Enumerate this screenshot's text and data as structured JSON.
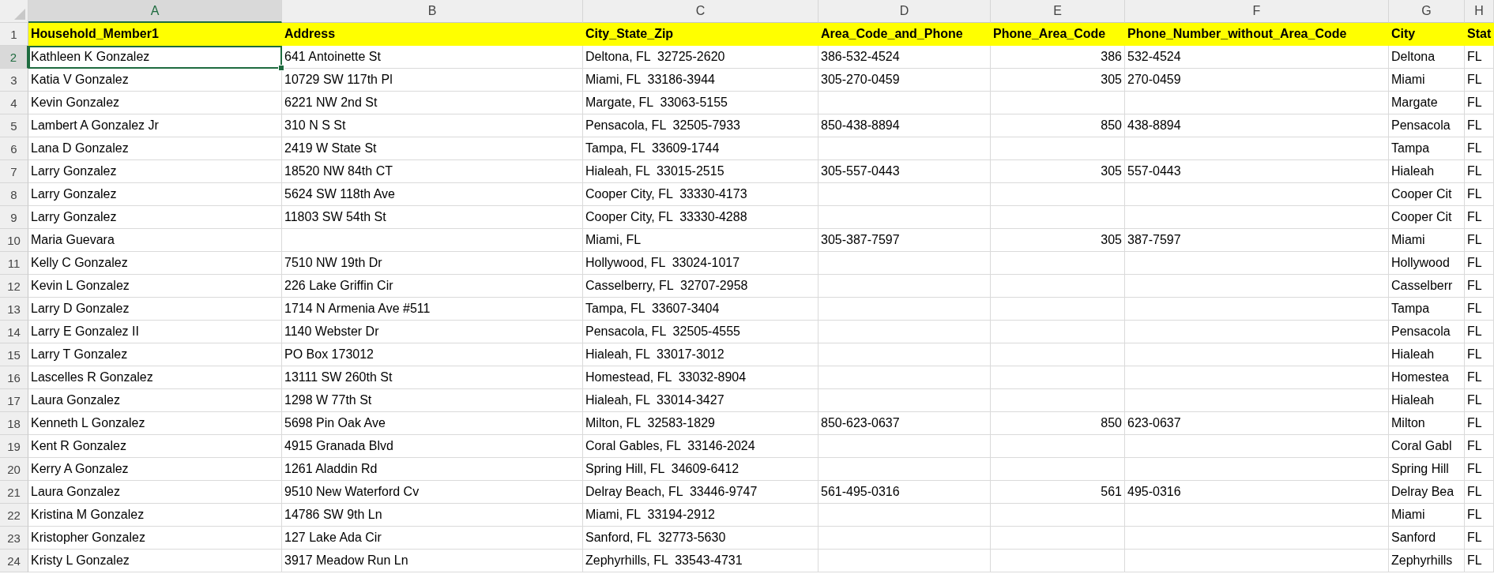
{
  "columns": [
    {
      "letter": "A",
      "selected": true,
      "right_aligned": false
    },
    {
      "letter": "B",
      "selected": false,
      "right_aligned": false
    },
    {
      "letter": "C",
      "selected": false,
      "right_aligned": false
    },
    {
      "letter": "D",
      "selected": false,
      "right_aligned": false
    },
    {
      "letter": "E",
      "selected": false,
      "right_aligned": true
    },
    {
      "letter": "F",
      "selected": false,
      "right_aligned": false
    },
    {
      "letter": "G",
      "selected": false,
      "right_aligned": false
    },
    {
      "letter": "H",
      "selected": false,
      "right_aligned": false
    }
  ],
  "rows": [
    {
      "number": "1",
      "selected": false,
      "kind": "header",
      "cells": [
        "Household_Member1",
        "Address",
        "City_State_Zip",
        "Area_Code_and_Phone",
        "Phone_Area_Code",
        "Phone_Number_without_Area_Code",
        "City",
        "Stat"
      ]
    },
    {
      "number": "2",
      "selected": true,
      "kind": "data",
      "cells": [
        "Kathleen K Gonzalez",
        "641 Antoinette St",
        "Deltona, FL  32725-2620",
        "386-532-4524",
        "386",
        "532-4524",
        "Deltona",
        "FL"
      ]
    },
    {
      "number": "3",
      "selected": false,
      "kind": "data",
      "cells": [
        "Katia V Gonzalez",
        "10729 SW 117th Pl",
        "Miami, FL  33186-3944",
        "305-270-0459",
        "305",
        "270-0459",
        "Miami",
        "FL"
      ]
    },
    {
      "number": "4",
      "selected": false,
      "kind": "data",
      "cells": [
        "Kevin Gonzalez",
        "6221 NW 2nd St",
        "Margate, FL  33063-5155",
        null,
        null,
        null,
        "Margate",
        "FL"
      ]
    },
    {
      "number": "5",
      "selected": false,
      "kind": "data",
      "cells": [
        "Lambert A Gonzalez Jr",
        "310 N S St",
        "Pensacola, FL  32505-7933",
        "850-438-8894",
        "850",
        "438-8894",
        "Pensacola",
        "FL"
      ]
    },
    {
      "number": "6",
      "selected": false,
      "kind": "data",
      "cells": [
        "Lana D Gonzalez",
        "2419 W State St",
        "Tampa, FL  33609-1744",
        null,
        null,
        null,
        "Tampa",
        "FL"
      ]
    },
    {
      "number": "7",
      "selected": false,
      "kind": "data",
      "cells": [
        "Larry Gonzalez",
        "18520 NW 84th CT",
        "Hialeah, FL  33015-2515",
        "305-557-0443",
        "305",
        "557-0443",
        "Hialeah",
        "FL"
      ]
    },
    {
      "number": "8",
      "selected": false,
      "kind": "data",
      "cells": [
        "Larry Gonzalez",
        "5624 SW 118th Ave",
        "Cooper City, FL  33330-4173",
        null,
        null,
        null,
        "Cooper Cit",
        "FL"
      ]
    },
    {
      "number": "9",
      "selected": false,
      "kind": "data",
      "cells": [
        "Larry Gonzalez",
        "11803 SW 54th St",
        "Cooper City, FL  33330-4288",
        null,
        null,
        null,
        "Cooper Cit",
        "FL"
      ]
    },
    {
      "number": "10",
      "selected": false,
      "kind": "data",
      "cells": [
        "Maria Guevara",
        null,
        "Miami, FL",
        "305-387-7597",
        "305",
        "387-7597",
        "Miami",
        "FL"
      ]
    },
    {
      "number": "11",
      "selected": false,
      "kind": "data",
      "cells": [
        "Kelly C Gonzalez",
        "7510 NW 19th Dr",
        "Hollywood, FL  33024-1017",
        null,
        null,
        null,
        "Hollywood",
        "FL"
      ]
    },
    {
      "number": "12",
      "selected": false,
      "kind": "data",
      "cells": [
        "Kevin L Gonzalez",
        "226 Lake Griffin Cir",
        "Casselberry, FL  32707-2958",
        null,
        null,
        null,
        "Casselberr",
        "FL"
      ]
    },
    {
      "number": "13",
      "selected": false,
      "kind": "data",
      "cells": [
        "Larry D Gonzalez",
        "1714 N Armenia Ave #511",
        "Tampa, FL  33607-3404",
        null,
        null,
        null,
        "Tampa",
        "FL"
      ]
    },
    {
      "number": "14",
      "selected": false,
      "kind": "data",
      "cells": [
        "Larry E Gonzalez II",
        "1140 Webster Dr",
        "Pensacola, FL  32505-4555",
        null,
        null,
        null,
        "Pensacola",
        "FL"
      ]
    },
    {
      "number": "15",
      "selected": false,
      "kind": "data",
      "cells": [
        "Larry T Gonzalez",
        "PO Box 173012",
        "Hialeah, FL  33017-3012",
        null,
        null,
        null,
        "Hialeah",
        "FL"
      ]
    },
    {
      "number": "16",
      "selected": false,
      "kind": "data",
      "cells": [
        "Lascelles R Gonzalez",
        "13111 SW 260th St",
        "Homestead, FL  33032-8904",
        null,
        null,
        null,
        "Homestea",
        "FL"
      ]
    },
    {
      "number": "17",
      "selected": false,
      "kind": "data",
      "cells": [
        "Laura Gonzalez",
        "1298 W 77th St",
        "Hialeah, FL  33014-3427",
        null,
        null,
        null,
        "Hialeah",
        "FL"
      ]
    },
    {
      "number": "18",
      "selected": false,
      "kind": "data",
      "cells": [
        "Kenneth L Gonzalez",
        "5698 Pin Oak Ave",
        "Milton, FL  32583-1829",
        "850-623-0637",
        "850",
        "623-0637",
        "Milton",
        "FL"
      ]
    },
    {
      "number": "19",
      "selected": false,
      "kind": "data",
      "cells": [
        "Kent R Gonzalez",
        "4915 Granada Blvd",
        "Coral Gables, FL  33146-2024",
        null,
        null,
        null,
        "Coral Gabl",
        "FL"
      ]
    },
    {
      "number": "20",
      "selected": false,
      "kind": "data",
      "cells": [
        "Kerry A Gonzalez",
        "1261 Aladdin Rd",
        "Spring Hill, FL  34609-6412",
        null,
        null,
        null,
        "Spring Hill",
        "FL"
      ]
    },
    {
      "number": "21",
      "selected": false,
      "kind": "data",
      "cells": [
        "Laura Gonzalez",
        "9510 New Waterford Cv",
        "Delray Beach, FL  33446-9747",
        "561-495-0316",
        "561",
        "495-0316",
        "Delray Bea",
        "FL"
      ]
    },
    {
      "number": "22",
      "selected": false,
      "kind": "data",
      "cells": [
        "Kristina M Gonzalez",
        "14786 SW 9th Ln",
        "Miami, FL  33194-2912",
        null,
        null,
        null,
        "Miami",
        "FL"
      ]
    },
    {
      "number": "23",
      "selected": false,
      "kind": "data",
      "cells": [
        "Kristopher Gonzalez",
        "127 Lake Ada Cir",
        "Sanford, FL  32773-5630",
        null,
        null,
        null,
        "Sanford",
        "FL"
      ]
    },
    {
      "number": "24",
      "selected": false,
      "kind": "data",
      "cells": [
        "Kristy L Gonzalez",
        "3917 Meadow Run Ln",
        "Zephyrhills, FL  33543-4731",
        null,
        null,
        null,
        "Zephyrhills",
        "FL"
      ]
    }
  ]
}
